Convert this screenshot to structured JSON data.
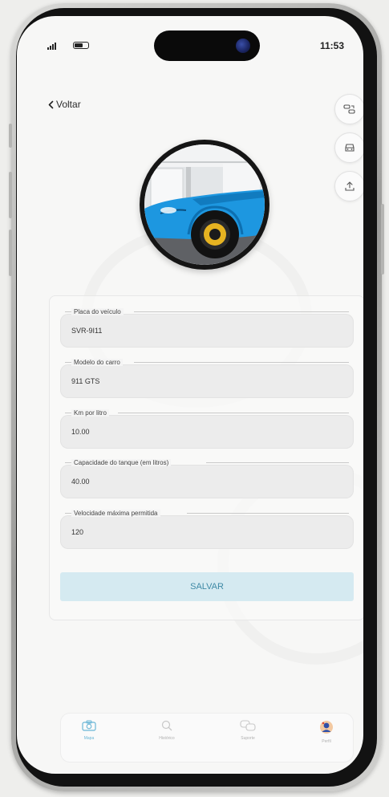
{
  "status_bar": {
    "time": "11:53"
  },
  "nav": {
    "back_label": "Voltar"
  },
  "form": {
    "fields": [
      {
        "label": "Placa do veículo",
        "value": "SVR-9I11"
      },
      {
        "label": "Modelo do carro",
        "value": "911 GTS"
      },
      {
        "label": "Km por litro",
        "value": "10.00"
      },
      {
        "label": "Capacidade do tanque (em litros)",
        "value": "40.00"
      },
      {
        "label": "Velocidade máxima permitida",
        "value": "120"
      }
    ],
    "save_label": "SALVAR"
  },
  "tab_bar": {
    "items": [
      {
        "label": "Mapa",
        "icon": "camera-icon",
        "active": true
      },
      {
        "label": "Histórico",
        "icon": "search-icon",
        "active": false
      },
      {
        "label": "Suporte",
        "icon": "chat-icon",
        "active": false
      },
      {
        "label": "Perfil",
        "icon": "profile-icon",
        "active": false
      }
    ]
  },
  "colors": {
    "accent": "#6ab6d6",
    "save_button_bg": "#d5eaf1",
    "save_button_text": "#3f8aa6",
    "car_body": "#1d97e0"
  }
}
